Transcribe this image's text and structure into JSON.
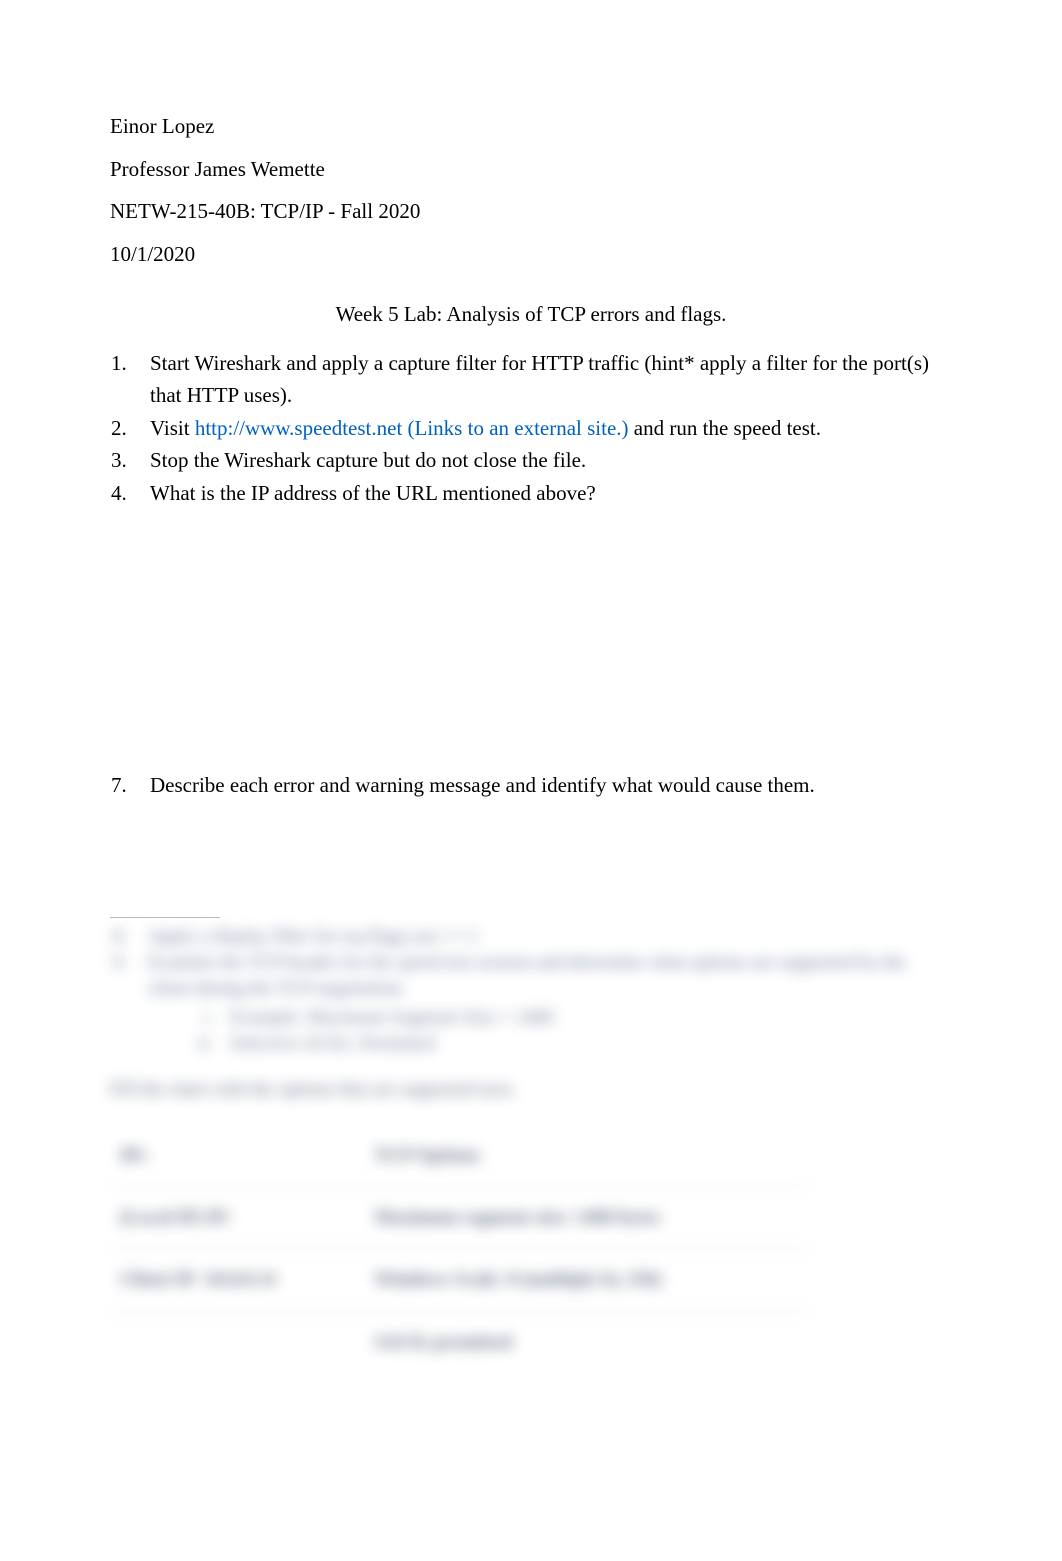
{
  "header": {
    "author": "Einor Lopez",
    "professor": "Professor James Wemette",
    "course": "NETW-215-40B: TCP/IP - Fall 2020",
    "date": "10/1/2020"
  },
  "doc_title": "Week 5 Lab: Analysis of TCP errors and flags.",
  "list": {
    "item1": "Start Wireshark and apply a capture filter for HTTP traffic (hint* apply a filter for the port(s) that HTTP uses).",
    "item2_pre": "Visit ",
    "item2_link": "http://www.speedtest.net (Links to an external site.)",
    "item2_post": " and run the speed test.",
    "item3": "Stop the Wireshark capture but do not close the file.",
    "item4": "What is the IP address of the URL mentioned above?",
    "item7": "Describe each error and warning message and identify what would cause them."
  },
  "blur": {
    "b1": "Apply a display filter for tcp.flags.syn == 1",
    "b2": "Examine the TCP header for the speed test session and determine what options are supported by the client during the TCP negotiation.",
    "sub1": "Example: Maximum Segment Size = 1460",
    "sub2": "Selective ACKs: Permitted",
    "para": "Fill the chart with the options that are supported now.",
    "table": {
      "h1": "IPs",
      "h2": "TCP Options",
      "r1c1": "(Local IP) IP:",
      "r1c2": "Maximum segment size: 1460 bytes",
      "r2c1": "Client IP: 10.0.0.14",
      "r2c2": "Windows Scale: 8 (multiply by 256)",
      "r3c1": "",
      "r3c2": "SACK permitted"
    }
  }
}
